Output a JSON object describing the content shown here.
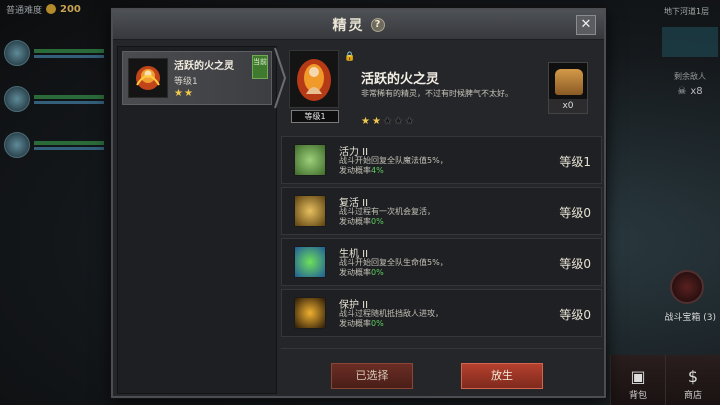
{
  "hud": {
    "difficulty": "普通难度",
    "gold": "200",
    "area_name": "地下河道1层",
    "enemies_label": "剩余敌人",
    "enemies_count": "x8",
    "chest_label": "战斗宝箱 (3)",
    "bag_label": "背包",
    "shop_label": "商店"
  },
  "modal": {
    "title": "精灵",
    "help": "?",
    "close": "✕"
  },
  "spirit_list": [
    {
      "name": "活跃的火之灵",
      "level": "等级1",
      "stars": "★★",
      "tag": "当前"
    }
  ],
  "detail": {
    "name": "活跃的火之灵",
    "description": "非常稀有的精灵，不过有时候脾气不太好。",
    "level_badge": "等级1",
    "stars_on": "★★",
    "stars_off": "★★★",
    "food_count": "x0"
  },
  "skills": [
    {
      "name": "活力 II",
      "line1": "战斗开始回复全队魔法值5%，",
      "prefix": "发动概率",
      "chance": "4%",
      "level": "等级1",
      "color": "#4e7a3a"
    },
    {
      "name": "复活 II",
      "line1": "战斗过程有一次机会复活，",
      "prefix": "发动概率",
      "chance": "0%",
      "level": "等级0",
      "color": "#6d5416"
    },
    {
      "name": "生机 II",
      "line1": "战斗开始回复全队生命值5%，",
      "prefix": "发动概率",
      "chance": "0%",
      "level": "等级0",
      "color": "#2f6a32"
    },
    {
      "name": "保护 II",
      "line1": "战斗过程随机抵挡敌人进攻，",
      "prefix": "发动概率",
      "chance": "0%",
      "level": "等级0",
      "color": "#6a4a12"
    }
  ],
  "actions": {
    "selected_label": "已选择",
    "release_label": "放生"
  }
}
